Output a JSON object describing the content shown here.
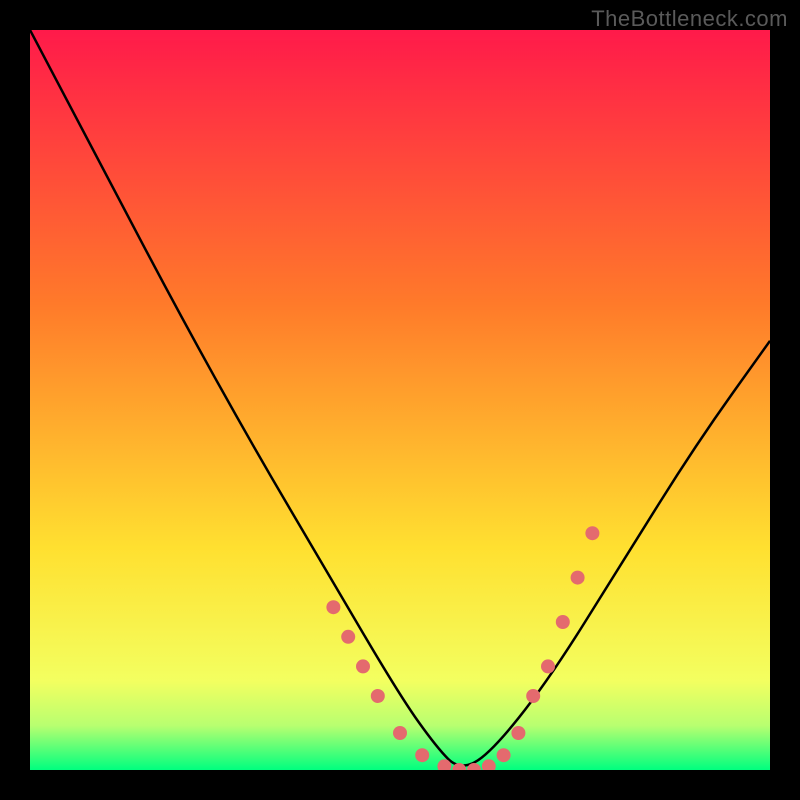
{
  "watermark": "TheBottleneck.com",
  "chart_data": {
    "type": "line",
    "title": "",
    "xlabel": "",
    "ylabel": "",
    "xlim": [
      0,
      100
    ],
    "ylim": [
      0,
      100
    ],
    "background_gradient": {
      "top": "#ff1a4a",
      "mid": "#ffd400",
      "bottom": "#00ff7f"
    },
    "curve": {
      "description": "V-shaped bottleneck curve; minimum around x≈58 at y≈0",
      "x": [
        0,
        10,
        20,
        30,
        40,
        50,
        55,
        58,
        62,
        70,
        80,
        90,
        100
      ],
      "y": [
        100,
        81,
        62,
        44,
        27,
        10,
        3,
        0,
        2,
        12,
        28,
        44,
        58
      ]
    },
    "marker_points": {
      "color": "#e46a6e",
      "radius_px": 7,
      "x": [
        41,
        43,
        45,
        47,
        50,
        53,
        56,
        58,
        60,
        62,
        64,
        66,
        68,
        70,
        72,
        74,
        76
      ],
      "y": [
        22,
        18,
        14,
        10,
        5,
        2,
        0.5,
        0,
        0,
        0.5,
        2,
        5,
        10,
        14,
        20,
        26,
        32
      ]
    }
  }
}
